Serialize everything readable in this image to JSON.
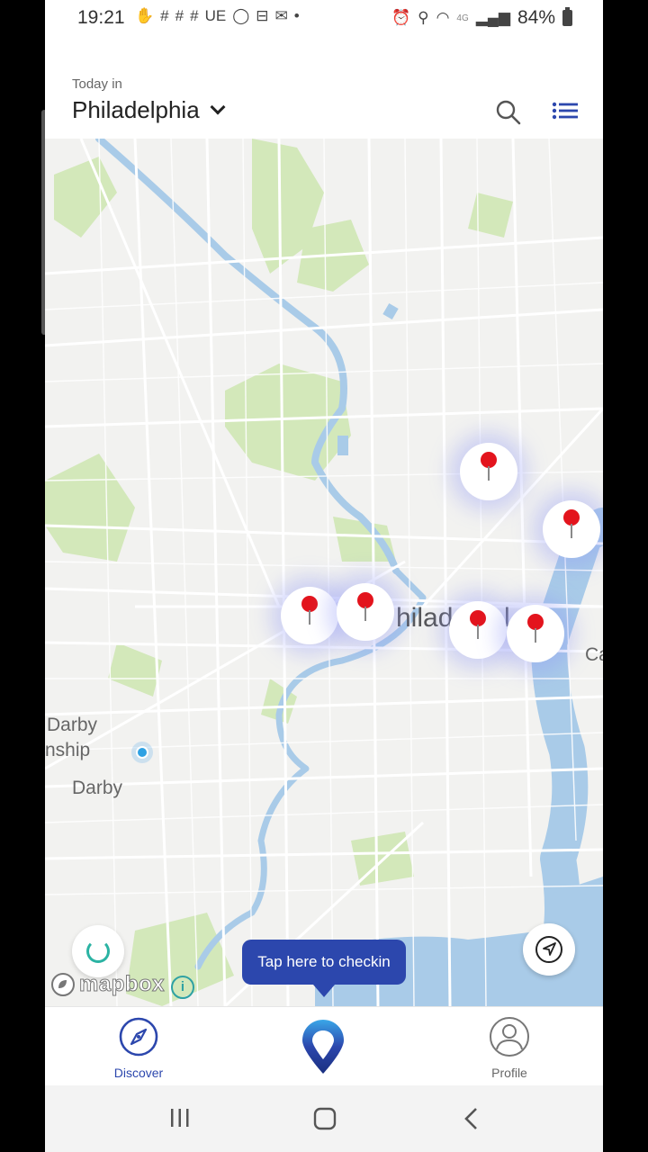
{
  "status_bar": {
    "time": "19:21",
    "notification_icons": [
      "hand-icon",
      "slack-icon",
      "slack-icon",
      "slack-icon",
      "ue-icon",
      "chat-icon",
      "print-icon",
      "mail-icon",
      "dot-icon"
    ],
    "ue_text": "UE",
    "network_label": "4G",
    "battery": "84%"
  },
  "header": {
    "subtitle": "Today in",
    "city": "Philadelphia"
  },
  "map": {
    "labels": {
      "darby_township_1": "Darby",
      "darby_township_2": "nship",
      "darby": "Darby",
      "city": "hilad",
      "city_suffix": "l",
      "camden": "Ca"
    },
    "pin_count": 6,
    "attribution": "mapbox",
    "info_symbol": "i",
    "colors": {
      "water": "#a9cbe8",
      "park": "#cfe6b4",
      "land": "#f2f2f0",
      "road": "#ffffff"
    }
  },
  "checkin_tooltip": "Tap here to checkin",
  "bottom_nav": {
    "discover": "Discover",
    "profile": "Profile"
  },
  "colors": {
    "accent": "#2c47ad",
    "pin": "#e3141d"
  }
}
